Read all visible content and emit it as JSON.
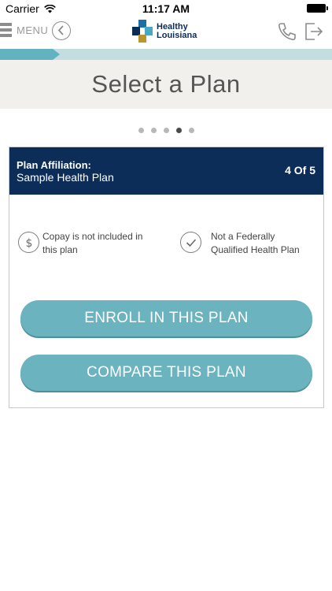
{
  "status_bar": {
    "carrier": "Carrier",
    "time": "11:17 AM"
  },
  "nav": {
    "menu_label": "MENU",
    "logo_line1": "Healthy",
    "logo_line2": "Louisiana"
  },
  "progress": {
    "fraction": 0.18
  },
  "header": {
    "title": "Select a Plan"
  },
  "pager": {
    "total": 5,
    "active_index": 3
  },
  "plan_card": {
    "affiliation_label": "Plan Affiliation:",
    "affiliation_value": "Sample Health Plan",
    "count": "4 Of 5",
    "features": [
      {
        "icon": "dollar-icon",
        "text_line1": "Copay is not included in",
        "text_line2": "this plan"
      },
      {
        "icon": "checkmark-icon",
        "text_line1": "Not a Federally",
        "text_line2": "Qualified Health Plan"
      }
    ],
    "enroll_label": "ENROLL IN THIS PLAN",
    "compare_label": "COMPARE THIS PLAN"
  },
  "colors": {
    "navy": "#0c2d57",
    "teal": "#6ab3bf",
    "title_band": "#f1f0ec"
  }
}
